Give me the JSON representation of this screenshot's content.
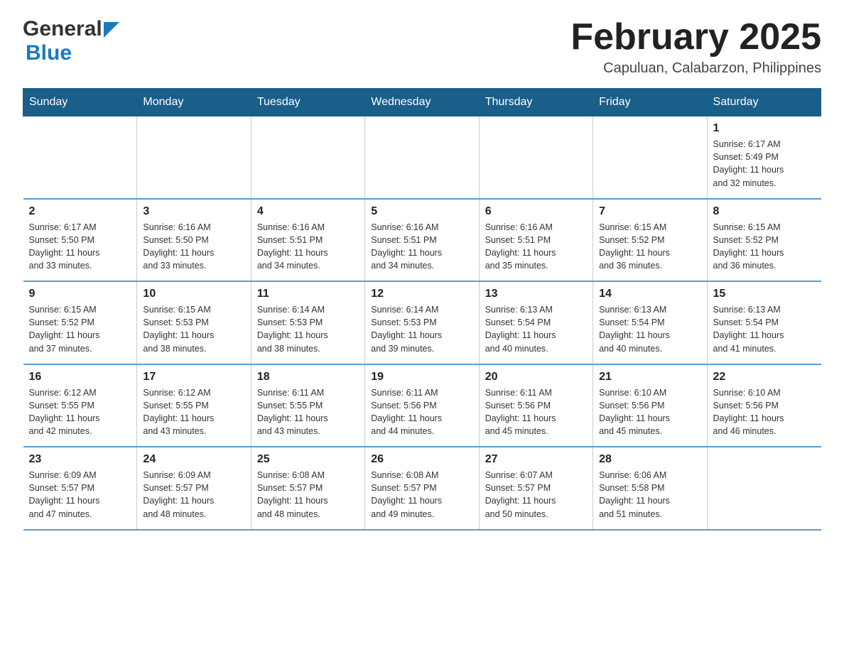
{
  "logo": {
    "text_general": "General",
    "text_blue": "Blue",
    "arrow_color": "#1a7abf"
  },
  "header": {
    "title": "February 2025",
    "location": "Capuluan, Calabarzon, Philippines"
  },
  "calendar": {
    "days_of_week": [
      "Sunday",
      "Monday",
      "Tuesday",
      "Wednesday",
      "Thursday",
      "Friday",
      "Saturday"
    ],
    "weeks": [
      [
        {
          "day": "",
          "info": ""
        },
        {
          "day": "",
          "info": ""
        },
        {
          "day": "",
          "info": ""
        },
        {
          "day": "",
          "info": ""
        },
        {
          "day": "",
          "info": ""
        },
        {
          "day": "",
          "info": ""
        },
        {
          "day": "1",
          "info": "Sunrise: 6:17 AM\nSunset: 5:49 PM\nDaylight: 11 hours\nand 32 minutes."
        }
      ],
      [
        {
          "day": "2",
          "info": "Sunrise: 6:17 AM\nSunset: 5:50 PM\nDaylight: 11 hours\nand 33 minutes."
        },
        {
          "day": "3",
          "info": "Sunrise: 6:16 AM\nSunset: 5:50 PM\nDaylight: 11 hours\nand 33 minutes."
        },
        {
          "day": "4",
          "info": "Sunrise: 6:16 AM\nSunset: 5:51 PM\nDaylight: 11 hours\nand 34 minutes."
        },
        {
          "day": "5",
          "info": "Sunrise: 6:16 AM\nSunset: 5:51 PM\nDaylight: 11 hours\nand 34 minutes."
        },
        {
          "day": "6",
          "info": "Sunrise: 6:16 AM\nSunset: 5:51 PM\nDaylight: 11 hours\nand 35 minutes."
        },
        {
          "day": "7",
          "info": "Sunrise: 6:15 AM\nSunset: 5:52 PM\nDaylight: 11 hours\nand 36 minutes."
        },
        {
          "day": "8",
          "info": "Sunrise: 6:15 AM\nSunset: 5:52 PM\nDaylight: 11 hours\nand 36 minutes."
        }
      ],
      [
        {
          "day": "9",
          "info": "Sunrise: 6:15 AM\nSunset: 5:52 PM\nDaylight: 11 hours\nand 37 minutes."
        },
        {
          "day": "10",
          "info": "Sunrise: 6:15 AM\nSunset: 5:53 PM\nDaylight: 11 hours\nand 38 minutes."
        },
        {
          "day": "11",
          "info": "Sunrise: 6:14 AM\nSunset: 5:53 PM\nDaylight: 11 hours\nand 38 minutes."
        },
        {
          "day": "12",
          "info": "Sunrise: 6:14 AM\nSunset: 5:53 PM\nDaylight: 11 hours\nand 39 minutes."
        },
        {
          "day": "13",
          "info": "Sunrise: 6:13 AM\nSunset: 5:54 PM\nDaylight: 11 hours\nand 40 minutes."
        },
        {
          "day": "14",
          "info": "Sunrise: 6:13 AM\nSunset: 5:54 PM\nDaylight: 11 hours\nand 40 minutes."
        },
        {
          "day": "15",
          "info": "Sunrise: 6:13 AM\nSunset: 5:54 PM\nDaylight: 11 hours\nand 41 minutes."
        }
      ],
      [
        {
          "day": "16",
          "info": "Sunrise: 6:12 AM\nSunset: 5:55 PM\nDaylight: 11 hours\nand 42 minutes."
        },
        {
          "day": "17",
          "info": "Sunrise: 6:12 AM\nSunset: 5:55 PM\nDaylight: 11 hours\nand 43 minutes."
        },
        {
          "day": "18",
          "info": "Sunrise: 6:11 AM\nSunset: 5:55 PM\nDaylight: 11 hours\nand 43 minutes."
        },
        {
          "day": "19",
          "info": "Sunrise: 6:11 AM\nSunset: 5:56 PM\nDaylight: 11 hours\nand 44 minutes."
        },
        {
          "day": "20",
          "info": "Sunrise: 6:11 AM\nSunset: 5:56 PM\nDaylight: 11 hours\nand 45 minutes."
        },
        {
          "day": "21",
          "info": "Sunrise: 6:10 AM\nSunset: 5:56 PM\nDaylight: 11 hours\nand 45 minutes."
        },
        {
          "day": "22",
          "info": "Sunrise: 6:10 AM\nSunset: 5:56 PM\nDaylight: 11 hours\nand 46 minutes."
        }
      ],
      [
        {
          "day": "23",
          "info": "Sunrise: 6:09 AM\nSunset: 5:57 PM\nDaylight: 11 hours\nand 47 minutes."
        },
        {
          "day": "24",
          "info": "Sunrise: 6:09 AM\nSunset: 5:57 PM\nDaylight: 11 hours\nand 48 minutes."
        },
        {
          "day": "25",
          "info": "Sunrise: 6:08 AM\nSunset: 5:57 PM\nDaylight: 11 hours\nand 48 minutes."
        },
        {
          "day": "26",
          "info": "Sunrise: 6:08 AM\nSunset: 5:57 PM\nDaylight: 11 hours\nand 49 minutes."
        },
        {
          "day": "27",
          "info": "Sunrise: 6:07 AM\nSunset: 5:57 PM\nDaylight: 11 hours\nand 50 minutes."
        },
        {
          "day": "28",
          "info": "Sunrise: 6:06 AM\nSunset: 5:58 PM\nDaylight: 11 hours\nand 51 minutes."
        },
        {
          "day": "",
          "info": ""
        }
      ]
    ]
  }
}
